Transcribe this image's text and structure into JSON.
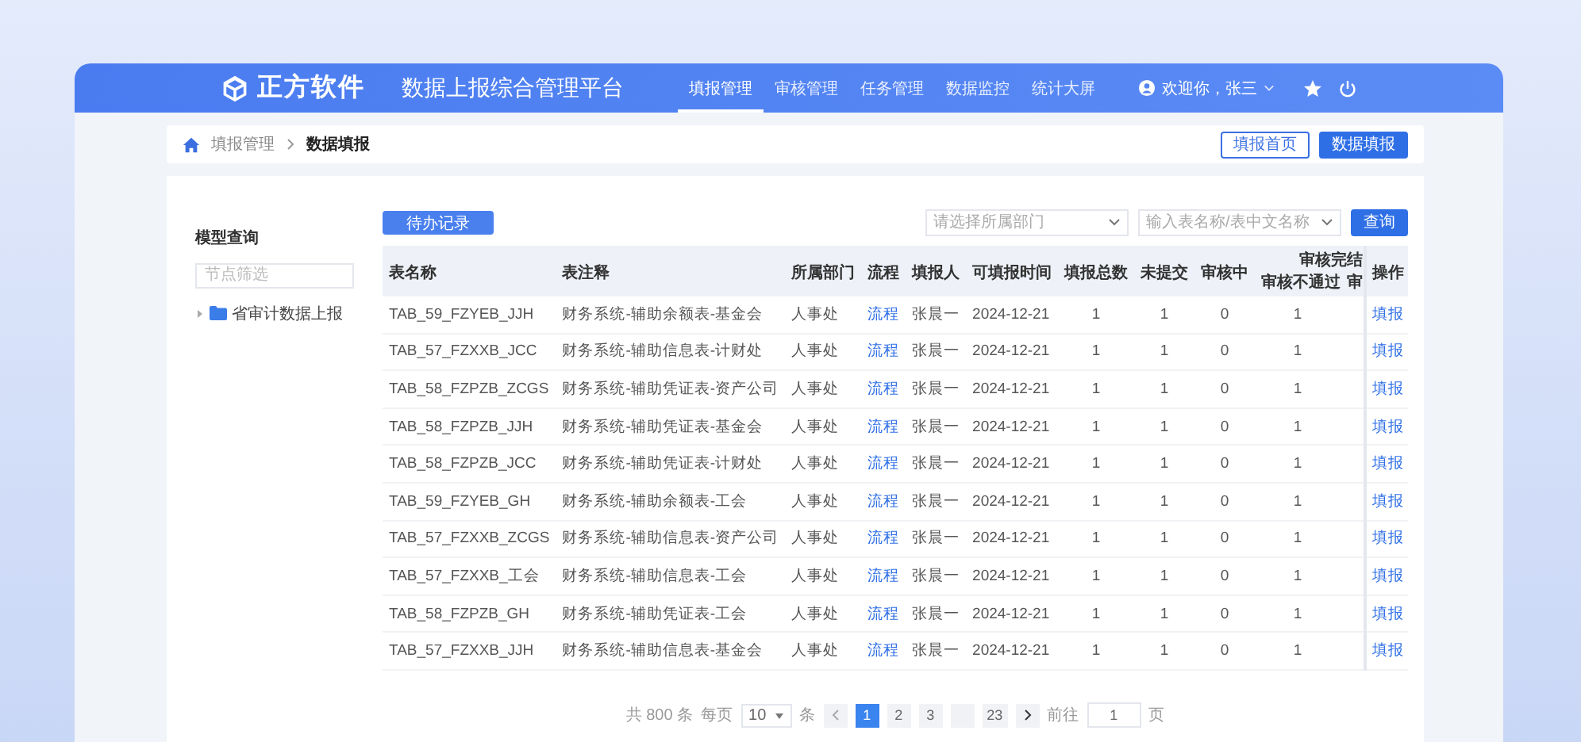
{
  "header": {
    "logo": "正方软件",
    "title": "数据上报综合管理平台",
    "nav": [
      {
        "label": "填报管理",
        "selected": true
      },
      {
        "label": "审核管理",
        "selected": false
      },
      {
        "label": "任务管理",
        "selected": false
      },
      {
        "label": "数据监控",
        "selected": false
      },
      {
        "label": "统计大屏",
        "selected": false
      }
    ],
    "user": "欢迎你，张三"
  },
  "breadcrumb": [
    "填报管理",
    "数据填报"
  ],
  "top_buttons": [
    {
      "label": "填报首页",
      "kind": "outline"
    },
    {
      "label": "数据填报",
      "kind": "primary"
    }
  ],
  "sidebar": {
    "title": "模型查询",
    "filter": {
      "placeholder": "节点筛选"
    },
    "tree": [
      {
        "label": "省审计数据上报",
        "expanded": false
      }
    ]
  },
  "toolbar": {
    "record_button": "待办记录",
    "department": {
      "placeholder": "请选择所属部门"
    },
    "search": {
      "placeholder": "输入表名称/表中文名称"
    },
    "query_button": "查询"
  },
  "table": {
    "columns": [
      "表名称",
      "表注释",
      "所属部门",
      "流程",
      "填报人",
      "可填报时间",
      "填报总数",
      "未提交",
      "审核中"
    ],
    "group": {
      "label": "审核完结",
      "sub": [
        "审核不通过",
        "审"
      ]
    },
    "action_column": "操作",
    "rows": [
      {
        "name": "TAB_59_FZYEB_JJH",
        "note": "财务系统-辅助余额表-基金会",
        "dept": "人事处",
        "flow": "流程",
        "filler": "张晨一",
        "date": "2024-12-21",
        "total": "1",
        "unsubmitted": "1",
        "reviewing": "0",
        "rejected": "1",
        "action": "填报"
      },
      {
        "name": "TAB_57_FZXXB_JCC",
        "note": "财务系统-辅助信息表-计财处",
        "dept": "人事处",
        "flow": "流程",
        "filler": "张晨一",
        "date": "2024-12-21",
        "total": "1",
        "unsubmitted": "1",
        "reviewing": "0",
        "rejected": "1",
        "action": "填报"
      },
      {
        "name": "TAB_58_FZPZB_ZCGS",
        "note": "财务系统-辅助凭证表-资产公司",
        "dept": "人事处",
        "flow": "流程",
        "filler": "张晨一",
        "date": "2024-12-21",
        "total": "1",
        "unsubmitted": "1",
        "reviewing": "0",
        "rejected": "1",
        "action": "填报"
      },
      {
        "name": "TAB_58_FZPZB_JJH",
        "note": "财务系统-辅助凭证表-基金会",
        "dept": "人事处",
        "flow": "流程",
        "filler": "张晨一",
        "date": "2024-12-21",
        "total": "1",
        "unsubmitted": "1",
        "reviewing": "0",
        "rejected": "1",
        "action": "填报"
      },
      {
        "name": "TAB_58_FZPZB_JCC",
        "note": "财务系统-辅助凭证表-计财处",
        "dept": "人事处",
        "flow": "流程",
        "filler": "张晨一",
        "date": "2024-12-21",
        "total": "1",
        "unsubmitted": "1",
        "reviewing": "0",
        "rejected": "1",
        "action": "填报"
      },
      {
        "name": "TAB_59_FZYEB_GH",
        "note": "财务系统-辅助余额表-工会",
        "dept": "人事处",
        "flow": "流程",
        "filler": "张晨一",
        "date": "2024-12-21",
        "total": "1",
        "unsubmitted": "1",
        "reviewing": "0",
        "rejected": "1",
        "action": "填报"
      },
      {
        "name": "TAB_57_FZXXB_ZCGS",
        "note": "财务系统-辅助信息表-资产公司",
        "dept": "人事处",
        "flow": "流程",
        "filler": "张晨一",
        "date": "2024-12-21",
        "total": "1",
        "unsubmitted": "1",
        "reviewing": "0",
        "rejected": "1",
        "action": "填报"
      },
      {
        "name": "TAB_57_FZXXB_工会",
        "note": "财务系统-辅助信息表-工会",
        "dept": "人事处",
        "flow": "流程",
        "filler": "张晨一",
        "date": "2024-12-21",
        "total": "1",
        "unsubmitted": "1",
        "reviewing": "0",
        "rejected": "1",
        "action": "填报"
      },
      {
        "name": "TAB_58_FZPZB_GH",
        "note": "财务系统-辅助凭证表-工会",
        "dept": "人事处",
        "flow": "流程",
        "filler": "张晨一",
        "date": "2024-12-21",
        "total": "1",
        "unsubmitted": "1",
        "reviewing": "0",
        "rejected": "1",
        "action": "填报"
      },
      {
        "name": "TAB_57_FZXXB_JJH",
        "note": "财务系统-辅助信息表-基金会",
        "dept": "人事处",
        "flow": "流程",
        "filler": "张晨一",
        "date": "2024-12-21",
        "total": "1",
        "unsubmitted": "1",
        "reviewing": "0",
        "rejected": "1",
        "action": "填报"
      }
    ]
  },
  "pagination": {
    "total": "共 800 条",
    "per_page_label": "每页",
    "per_page": "10",
    "per_page_unit": "条",
    "pages": [
      {
        "kind": "page",
        "label": "1",
        "selected": true
      },
      {
        "kind": "page",
        "label": "2",
        "selected": false
      },
      {
        "kind": "page",
        "label": "3",
        "selected": false
      },
      {
        "kind": "more"
      },
      {
        "kind": "page",
        "label": "23",
        "selected": false
      }
    ],
    "jump_label": "前往",
    "jump_value": "1",
    "jump_unit": "页"
  }
}
